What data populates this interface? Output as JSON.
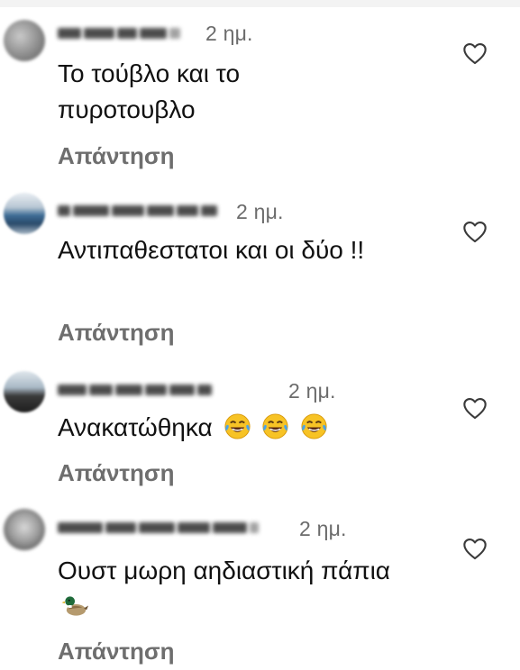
{
  "reply_label": "Απάντηση",
  "comments": [
    {
      "time": "2 ημ.",
      "text": "Το τούβλο και το πυροτουβλο",
      "liked": false
    },
    {
      "time": "2 ημ.",
      "text": "Αντιπαθεστατοι και οι δύο !!",
      "liked": false
    },
    {
      "time": "2 ημ.",
      "text": "Ανακατώθηκα",
      "emojis": [
        "face-with-tears-of-joy-icon",
        "face-with-tears-of-joy-icon",
        "face-with-tears-of-joy-icon"
      ],
      "liked": false
    },
    {
      "time": "2 ημ.",
      "text": "Ουστ μωρη αηδιαστική πάπια",
      "emojis": [
        "duck-icon"
      ],
      "liked": false
    }
  ],
  "colors": {
    "text": "#111111",
    "meta": "#6b6b6b",
    "reply": "#6e6e6e"
  }
}
